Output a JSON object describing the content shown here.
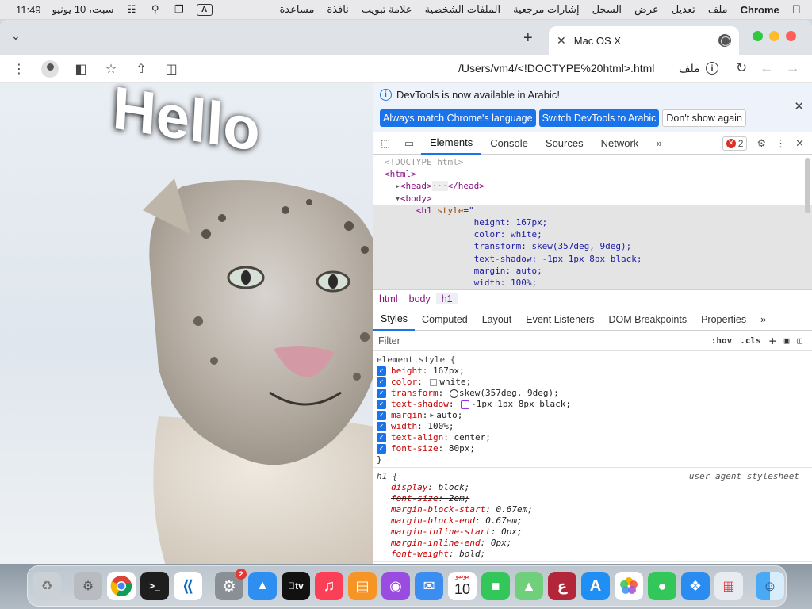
{
  "menubar": {
    "app": "Chrome",
    "menus": [
      "ملف",
      "تعديل",
      "عرض",
      "السجل",
      "إشارات مرجعية",
      "الملفات الشخصية",
      "علامة تبويب",
      "نافذة",
      "مساعدة"
    ],
    "time": "11:49",
    "date": "سبت، 10 يونيو",
    "input_indicator": "A"
  },
  "tab": {
    "title": "Mac OS X"
  },
  "toolbar": {
    "url": "/Users/vm4/<!DOCTYPE%20html>.html",
    "url_prefix": "ملف"
  },
  "page": {
    "heading": "Hello"
  },
  "devtools": {
    "infobar": {
      "message": "DevTools is now available in Arabic!",
      "btn_match": "Always match Chrome's language",
      "btn_switch": "Switch DevTools to Arabic",
      "btn_dismiss": "Don't show again"
    },
    "tabs": [
      "Elements",
      "Console",
      "Sources",
      "Network"
    ],
    "error_count": "2",
    "dom": {
      "doctype": "<!DOCTYPE html>",
      "html_open": "<html>",
      "head": "<head>",
      "head_ellipsis": "···",
      "head_close": "</head>",
      "body_open": "<body>",
      "h1_open": "<h1",
      "style_attr": "style",
      "style_eq": "=\"",
      "style_lines": [
        "height: 167px;",
        "color: white;",
        "transform: skew(357deg, 9deg);",
        "text-shadow: -1px 1px 8px black;",
        "margin: auto;",
        "width: 100%;"
      ]
    },
    "breadcrumbs": [
      "html",
      "body",
      "h1"
    ],
    "subtabs": [
      "Styles",
      "Computed",
      "Layout",
      "Event Listeners",
      "DOM Breakpoints",
      "Properties"
    ],
    "filter_placeholder": "Filter",
    "filter_hov": ":hov",
    "filter_cls": ".cls",
    "element_style": {
      "selector": "element.style {",
      "decls": [
        {
          "prop": "height",
          "value": "167px;"
        },
        {
          "prop": "color",
          "value": "white;"
        },
        {
          "prop": "transform",
          "value": "skew(357deg, 9deg);"
        },
        {
          "prop": "text-shadow",
          "value": "-1px 1px 8px black;"
        },
        {
          "prop": "margin",
          "value": "auto;"
        },
        {
          "prop": "width",
          "value": "100%;"
        },
        {
          "prop": "text-align",
          "value": "center;"
        },
        {
          "prop": "font-size",
          "value": "80px;"
        }
      ],
      "close": "}"
    },
    "ua_rule": {
      "selector": "h1 {",
      "source": "user agent stylesheet",
      "decls": [
        {
          "prop": "display",
          "value": "block;"
        },
        {
          "prop": "font-size",
          "value": "2em;"
        },
        {
          "prop": "margin-block-start",
          "value": "0.67em;"
        },
        {
          "prop": "margin-block-end",
          "value": "0.67em;"
        },
        {
          "prop": "margin-inline-start",
          "value": "0px;"
        },
        {
          "prop": "margin-inline-end",
          "value": "0px;"
        },
        {
          "prop": "font-weight",
          "value": "bold;"
        }
      ]
    }
  },
  "dock": {
    "settings_badge": "2",
    "calendar_month": "يونيو",
    "calendar_day": "10",
    "appletv_label": "tv",
    "dictionary_label": "ع"
  },
  "colors": {
    "accent": "#1a73e8",
    "error": "#d93025",
    "traffic_green": "#2fc840",
    "traffic_yellow": "#fdbc2e",
    "traffic_red": "#fe5f57"
  }
}
